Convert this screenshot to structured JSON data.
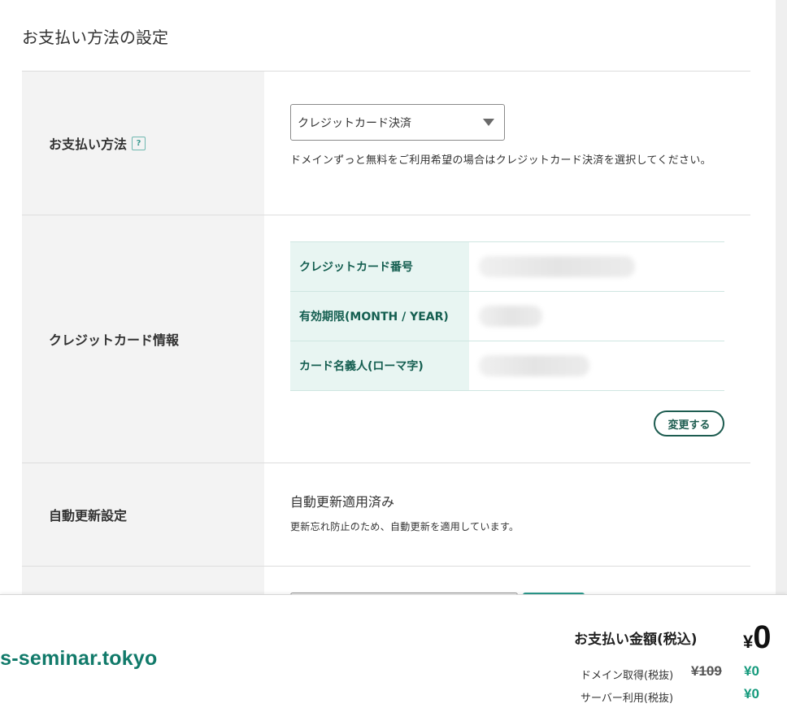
{
  "section_title": "お支払い方法の設定",
  "payment_method": {
    "label": "お支払い方法",
    "help": "?",
    "selected": "クレジットカード決済",
    "note": "ドメインずっと無料をご利用希望の場合はクレジットカード決済を選択してください。"
  },
  "credit_card": {
    "label": "クレジットカード情報",
    "rows": [
      {
        "key": "クレジットカード番号"
      },
      {
        "key": "有効期限(MONTH / YEAR)"
      },
      {
        "key": "カード名義人(ローマ字)"
      }
    ],
    "change_label": "変更する"
  },
  "auto_renew": {
    "label": "自動更新設定",
    "status": "自動更新適用済み",
    "note": "更新忘れ防止のため、自動更新を適用しています。"
  },
  "footer": {
    "domain": "cs-seminar.tokyo",
    "total_label": "お支払い金額(税込)",
    "total_currency": "¥",
    "total_amount": "0",
    "lines": [
      {
        "label": "ドメイン取得(税抜)",
        "original": "¥109",
        "value": "¥0"
      },
      {
        "label": "サーバー利用(税抜)",
        "value": "¥0"
      }
    ]
  },
  "colors": {
    "accent": "#117a6a",
    "price_green": "#149a7c",
    "header_bg": "#e8f5f2"
  }
}
